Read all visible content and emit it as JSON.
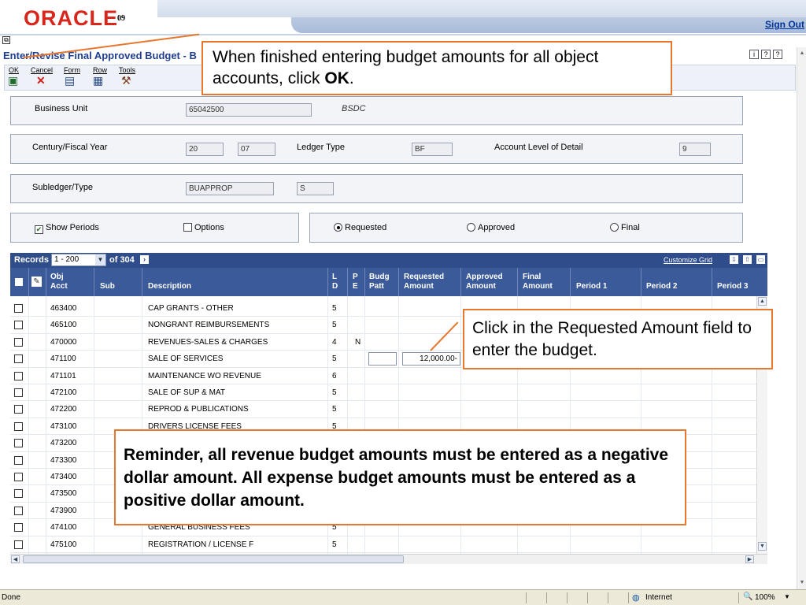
{
  "header": {
    "logo_text": "ORACLE",
    "logo_version": "09",
    "sign_out": "Sign Out"
  },
  "form": {
    "title": "Enter/Revise Final Approved Budget - B",
    "menu": [
      {
        "label": "OK"
      },
      {
        "label": "Cancel"
      },
      {
        "label": "Form"
      },
      {
        "label": "Row"
      },
      {
        "label": "Tools"
      }
    ],
    "help_icons": [
      "i",
      "?",
      "?"
    ]
  },
  "business_unit": {
    "label": "Business Unit",
    "value": "65042500",
    "description": "BSDC"
  },
  "fiscal": {
    "century_label": "Century/Fiscal Year",
    "century": "20",
    "year": "07",
    "ledger_label": "Ledger Type",
    "ledger": "BF",
    "level_label": "Account Level of Detail",
    "level": "9"
  },
  "subledger": {
    "label": "Subledger/Type",
    "value": "BUAPPROP",
    "type": "S"
  },
  "options": {
    "show_periods": "Show Periods",
    "options": "Options",
    "requested": "Requested",
    "approved": "Approved",
    "final": "Final"
  },
  "grid": {
    "records_label": "Records",
    "records_range": "1 - 200",
    "records_total": "of 304",
    "customize": "Customize Grid",
    "columns": {
      "obj1": "Obj",
      "obj2": "Acct",
      "sub": "Sub",
      "desc": "Description",
      "l1": "L",
      "l2": "D",
      "p1": "P",
      "p2": "E",
      "budg1": "Budg",
      "budg2": "Patt",
      "req1": "Requested",
      "req2": "Amount",
      "app1": "Approved",
      "app2": "Amount",
      "fin1": "Final",
      "fin2": "Amount",
      "per1": "Period 1",
      "per2": "Period 2",
      "per3": "Period 3"
    },
    "rows": [
      {
        "acct": "463400",
        "desc": "CAP GRANTS - OTHER",
        "ld": "5",
        "pe": "",
        "req": ""
      },
      {
        "acct": "465100",
        "desc": "NONGRANT REIMBURSEMENTS",
        "ld": "5",
        "pe": "",
        "req": ""
      },
      {
        "acct": "470000",
        "desc": "REVENUES-SALES & CHARGES",
        "ld": "4",
        "pe": "N",
        "req": ""
      },
      {
        "acct": "471100",
        "desc": "SALE OF SERVICES",
        "ld": "5",
        "pe": "",
        "req": "12,000.00-"
      },
      {
        "acct": "471101",
        "desc": "MAINTENANCE WO REVENUE",
        "ld": "6",
        "pe": "",
        "req": ""
      },
      {
        "acct": "472100",
        "desc": "SALE OF SUP & MAT",
        "ld": "5",
        "pe": "",
        "req": ""
      },
      {
        "acct": "472200",
        "desc": "REPROD & PUBLICATIONS",
        "ld": "5",
        "pe": "",
        "req": ""
      },
      {
        "acct": "473100",
        "desc": "DRIVERS LICENSE FEES",
        "ld": "5",
        "pe": "",
        "req": ""
      },
      {
        "acct": "473200",
        "desc": "",
        "ld": "",
        "pe": "",
        "req": ""
      },
      {
        "acct": "473300",
        "desc": "",
        "ld": "",
        "pe": "",
        "req": ""
      },
      {
        "acct": "473400",
        "desc": "",
        "ld": "",
        "pe": "",
        "req": ""
      },
      {
        "acct": "473500",
        "desc": "",
        "ld": "",
        "pe": "",
        "req": ""
      },
      {
        "acct": "473900",
        "desc": "",
        "ld": "",
        "pe": "",
        "req": ""
      },
      {
        "acct": "474100",
        "desc": "GENERAL BUSINESS FEES",
        "ld": "5",
        "pe": "",
        "req": ""
      },
      {
        "acct": "475100",
        "desc": "REGISTRATION / LICENSE F",
        "ld": "5",
        "pe": "",
        "req": ""
      }
    ]
  },
  "callouts": {
    "ok_pre": "When finished entering budget amounts for all object accounts, click ",
    "ok_bold": "OK",
    "ok_post": ".",
    "requested": "Click in the Requested Amount field to enter the budget.",
    "reminder": "Reminder, all revenue budget amounts must be entered as a negative dollar amount.  All expense budget amounts must be entered as a positive dollar amount."
  },
  "status": {
    "left": "Done",
    "zone": "Internet",
    "zoom": "100%"
  },
  "colors": {
    "accent": "#e8772e",
    "grid_header": "#3a5a9a",
    "oracle_red": "#d9261c"
  }
}
